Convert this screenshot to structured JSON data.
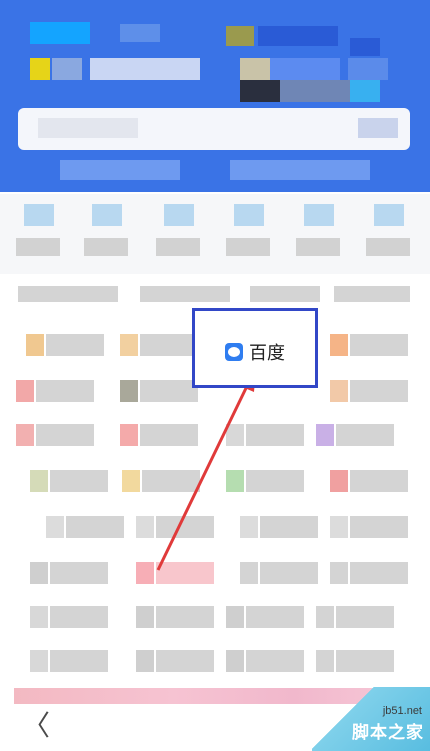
{
  "callout": {
    "label": "百度",
    "icon": "baidu-paw-icon"
  },
  "watermark": {
    "site": "jb51.net",
    "brand": "脚本之家"
  },
  "navigation": {
    "back_icon": "chevron-left-icon",
    "back_glyph": "〈"
  },
  "colors": {
    "header": "#3a73e6",
    "highlight_border": "#3247c7",
    "arrow": "#e03a3a",
    "baidu_blue": "#2f7df0"
  }
}
